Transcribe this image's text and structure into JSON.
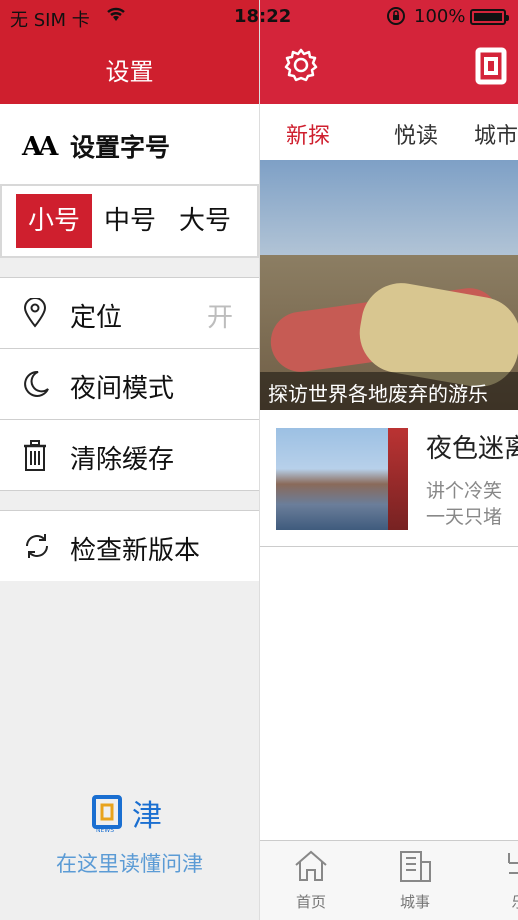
{
  "status_bar": {
    "carrier": "无 SIM 卡",
    "time": "18:22",
    "battery": "100%"
  },
  "settings": {
    "title": "设置",
    "font_size_section": {
      "label": "设置字号",
      "options": [
        "小号",
        "中号",
        "大号"
      ],
      "selected": "小号"
    },
    "items": [
      {
        "label": "定位",
        "value": "开",
        "icon": "location-pin-icon"
      },
      {
        "label": "夜间模式",
        "icon": "moon-icon"
      },
      {
        "label": "清除缓存",
        "icon": "trash-icon"
      },
      {
        "label": "检查新版本",
        "icon": "refresh-icon"
      }
    ],
    "brand": {
      "logo_text": "问津",
      "tagline": "在这里读懂问津"
    }
  },
  "content": {
    "tabs": [
      {
        "label": "新探",
        "active": true
      },
      {
        "label": "悦读"
      },
      {
        "label": "城市"
      }
    ],
    "hero": {
      "caption": "探访世界各地废弃的游乐"
    },
    "article": {
      "title": "夜色迷离",
      "desc_line1": "讲个冷笑",
      "desc_line2": "一天只堵"
    },
    "tabbar": [
      {
        "label": "首页",
        "icon": "home-icon"
      },
      {
        "label": "城事",
        "icon": "building-icon"
      },
      {
        "label": "乐",
        "icon": "partial-icon"
      }
    ]
  },
  "colors": {
    "brand_red": "#cf1f2e",
    "tagline_blue": "#5b9bd5"
  }
}
